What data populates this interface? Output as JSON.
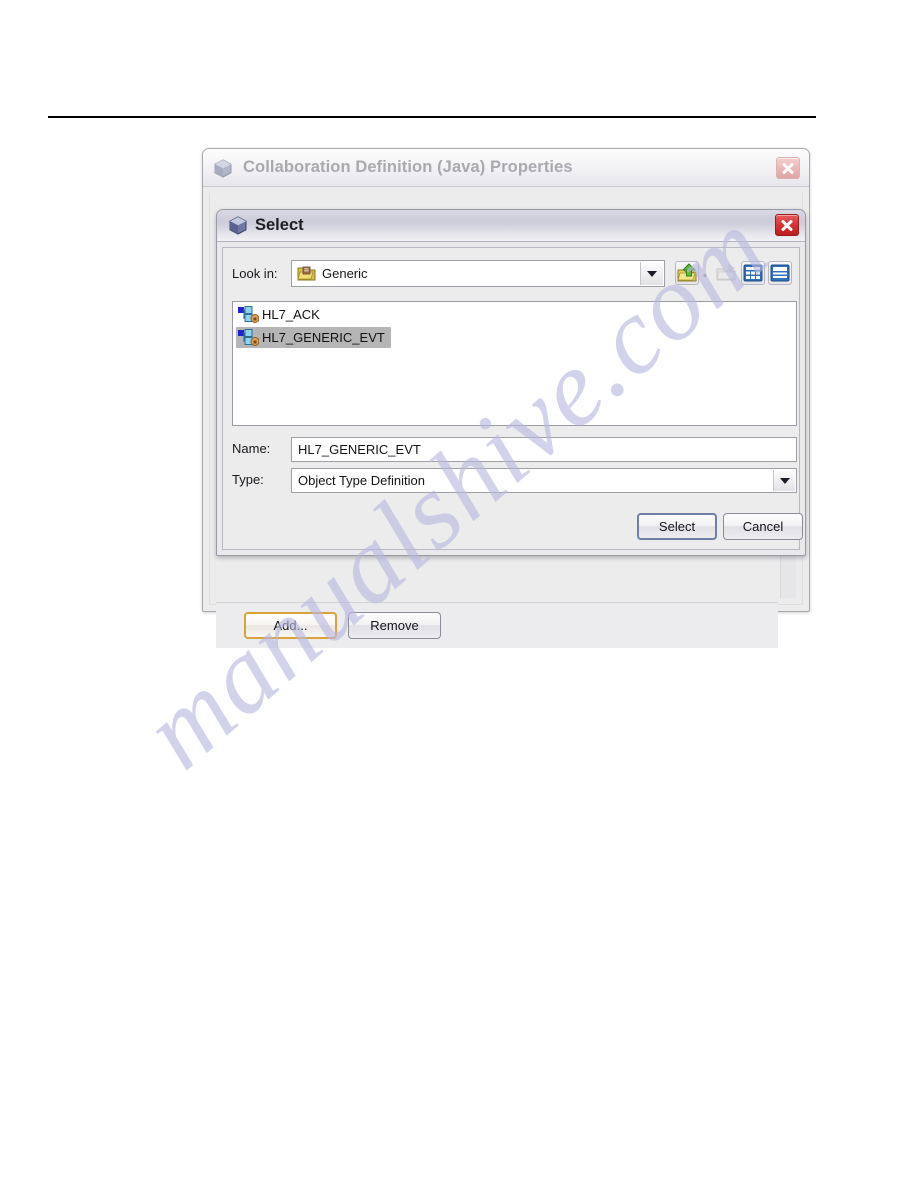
{
  "page": {
    "rule": "horizontal-rule",
    "watermark": "manualshive.com"
  },
  "background_dialog": {
    "title": "Collaboration Definition (Java) Properties",
    "icon": "cube-icon",
    "close_label": "✕",
    "buttons": [
      {
        "label": "Add...",
        "state": "focused"
      },
      {
        "label": "Remove",
        "state": "normal"
      }
    ]
  },
  "select_dialog": {
    "title": "Select",
    "icon": "cube-icon",
    "close_label": "✕",
    "lookin": {
      "label": "Look in:",
      "value": "Generic",
      "icon": "folder-icon"
    },
    "toolbar": [
      {
        "name": "up-one-level-icon",
        "state": "enabled"
      },
      {
        "name": "separator-dot",
        "state": "static"
      },
      {
        "name": "new-folder-icon",
        "state": "disabled"
      },
      {
        "name": "list-view-icon",
        "state": "enabled"
      },
      {
        "name": "details-view-icon",
        "state": "enabled"
      }
    ],
    "list": [
      {
        "label": "HL7_ACK",
        "selected": false,
        "icon": "object-type-definition-icon"
      },
      {
        "label": "HL7_GENERIC_EVT",
        "selected": true,
        "icon": "object-type-definition-icon"
      }
    ],
    "fields": {
      "name_label": "Name:",
      "name_value": "HL7_GENERIC_EVT",
      "type_label": "Type:",
      "type_value": "Object Type Definition"
    },
    "buttons": [
      {
        "label": "Select",
        "state": "default"
      },
      {
        "label": "Cancel",
        "state": "normal"
      }
    ]
  },
  "colors": {
    "close_active": "#d3302f",
    "close_inactive": "#eab6b6",
    "selection": "#b5b5b5",
    "focus_gold": "#d9a23a",
    "default_border": "#6f7fa6",
    "watermark": "#b9b8e0"
  }
}
